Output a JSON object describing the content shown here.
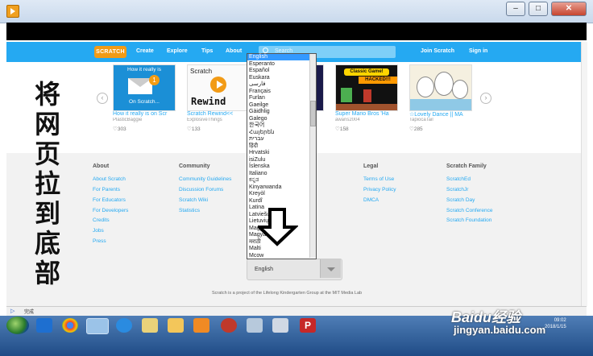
{
  "navbar": {
    "logo": "SCRATCH",
    "links": [
      "Create",
      "Explore",
      "Tips",
      "About"
    ],
    "search_placeholder": "Search",
    "join": "Join Scratch",
    "signin": "Sign in"
  },
  "carousel": {
    "items": [
      {
        "thumb_line1": "How it really is",
        "thumb_line2": "On Scratch...",
        "badge": "1",
        "title": "How it really is on Scr",
        "author": "PlasticBaggie",
        "loves": "303"
      },
      {
        "thumb_line1": "Scratch",
        "thumb_line2": "Rewind",
        "title": "Scratch Rewind<<",
        "author": "ExplosiveThings",
        "loves": "133"
      },
      {
        "thumb_line1": "Classic Game!",
        "thumb_line2": "HACKED!!!",
        "title": "Super Mario Bros 'Ha",
        "author": "awaris2004",
        "loves": "158"
      },
      {
        "title": "☆Lovely Dance || MA",
        "author": "TapiocaTail",
        "loves": "285"
      }
    ]
  },
  "footer": {
    "about": {
      "heading": "About",
      "links": [
        "About Scratch",
        "For Parents",
        "For Educators",
        "For Developers",
        "Credits",
        "Jobs",
        "Press"
      ]
    },
    "community": {
      "heading": "Community",
      "links": [
        "Community Guidelines",
        "Discussion Forums",
        "Scratch Wiki",
        "Statistics"
      ]
    },
    "legal": {
      "heading": "Legal",
      "links": [
        "Terms of Use",
        "Privacy Policy",
        "DMCA"
      ]
    },
    "family": {
      "heading": "Scratch Family",
      "links": [
        "ScratchEd",
        "ScratchJr",
        "Scratch Day",
        "Scratch Conference",
        "Scratch Foundation"
      ]
    },
    "credit": "Scratch is a project of the Lifelong Kindergarten Group at the MIT Media Lab"
  },
  "language": {
    "selected": "English",
    "options": [
      "English",
      "Esperanto",
      "Español",
      "Euskara",
      "فارسی",
      "Français",
      "Furlan",
      "Gaeilge",
      "Gàidhlig",
      "Galego",
      "한국어",
      "Հայերեն",
      "עברית",
      "हिंदी",
      "Hrvatski",
      "isiZulu",
      "Íslenska",
      "Italiano",
      "ಕನ್ನಡ",
      "Kinyarwanda",
      "Kreyòl",
      "Kurdî",
      "Latina",
      "Latviešu",
      "Lietuvių",
      "Magyar",
      "Magyar",
      "मराठी",
      "Malti",
      "Mcow"
    ]
  },
  "annotation_text": [
    "将",
    "网",
    "页",
    "拉",
    "到",
    "底",
    "部"
  ],
  "statusbar": {
    "text": "完成"
  },
  "taskbar": {
    "time": "09:02",
    "date": "2018/1/15"
  },
  "watermark": {
    "line1": "Baidu经验",
    "line2": "jingyan.baidu.com"
  },
  "colors": {
    "nav": "#25a9f2",
    "logo": "#f29b16",
    "link": "#25a9f2",
    "select_highlight": "#3399ff"
  }
}
